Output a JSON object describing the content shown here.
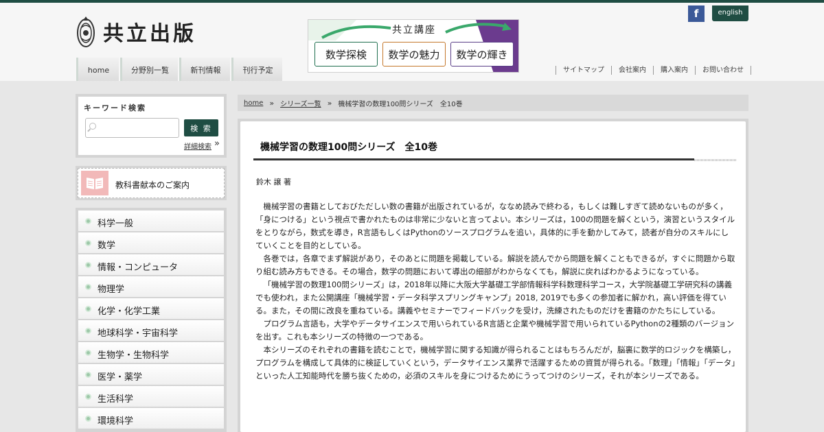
{
  "header": {
    "logo_text": "共立出版",
    "banner": {
      "title": "共立講座",
      "items": [
        "数学探検",
        "数学の魅力",
        "数学の輝き"
      ]
    },
    "facebook_label": "f",
    "english_label": "english",
    "global_nav": [
      "home",
      "分野別一覧",
      "新刊情報",
      "刊行予定"
    ],
    "util_nav": [
      "サイトマップ",
      "会社案内",
      "購入案内",
      "お問い合わせ"
    ]
  },
  "sidebar": {
    "search": {
      "title": "キーワード検索",
      "placeholder": "",
      "button_label": "検 索",
      "advanced_label": "詳細検索",
      "advanced_arrow": "»"
    },
    "textbook_label": "教科書献本のご案内",
    "categories": [
      "科学一般",
      "数学",
      "情報・コンピュータ",
      "物理学",
      "化学・化学工業",
      "地球科学・宇宙科学",
      "生物学・生物科学",
      "医学・薬学",
      "生活科学",
      "環境科学"
    ]
  },
  "breadcrumb": {
    "home": "home",
    "sep": "»",
    "series": "シリーズ一覧",
    "current": "機械学習の数理100問シリーズ　全10巻"
  },
  "article": {
    "title": "機械学習の数理100問シリーズ　全10巻",
    "author": "鈴木 譲 著",
    "paragraphs": [
      "機械学習の書籍としておびただしい数の書籍が出版されているが，ななめ読みで終わる，もしくは難しすぎて読めないものが多く，「身につける」という視点で書かれたものは非常に少ないと言ってよい。本シリーズは，100の問題を解くという，演習というスタイルをとりながら，数式を導き，R言語もしくはPythonのソースプログラムを追い，具体的に手を動かしてみて，読者が自分のスキルにしていくことを目的としている。",
      "各巻では，各章でまず解説があり，そのあとに問題を掲載している。解説を読んでから問題を解くこともできるが，すぐに問題から取り組む読み方もできる。その場合，数学の問題において導出の細部がわからなくても，解説に戻ればわかるようになっている。",
      "「機械学習の数理100問シリーズ」は，2018年以降に大阪大学基礎工学部情報科学科数理科学コース，大学院基礎工学研究科の講義でも使われ，また公開講座「機械学習・データ科学スプリングキャンプ」2018, 2019でも多くの参加者に解かれ，高い評価を得ている。また，その間に改良を重ねている。講義やセミナーでフィードバックを受け，洗練されたものだけを書籍のかたちにしている。",
      "プログラム言語も，大学やデータサイエンスで用いられているR言語と企業や機械学習で用いられているPythonの2種類のバージョンを出す。これも本シリーズの特徴の一つである。",
      "本シリーズのそれぞれの書籍を読むことで，機械学習に関する知識が得られることはもちろんだが，脳裏に数学的ロジックを構築し，プログラムを構成して具体的に検証していくという，データサイエンス業界で活躍するための資質が得られる。「数理」「情報」「データ」といった人工知能時代を勝ち抜くための，必須のスキルを身につけるためにうってつけのシリーズ，それが本シリーズである。"
    ]
  },
  "colors": {
    "brand_green": "#1f4d43",
    "facebook_blue": "#3b5998",
    "category_dot": "#9dc8a8"
  }
}
